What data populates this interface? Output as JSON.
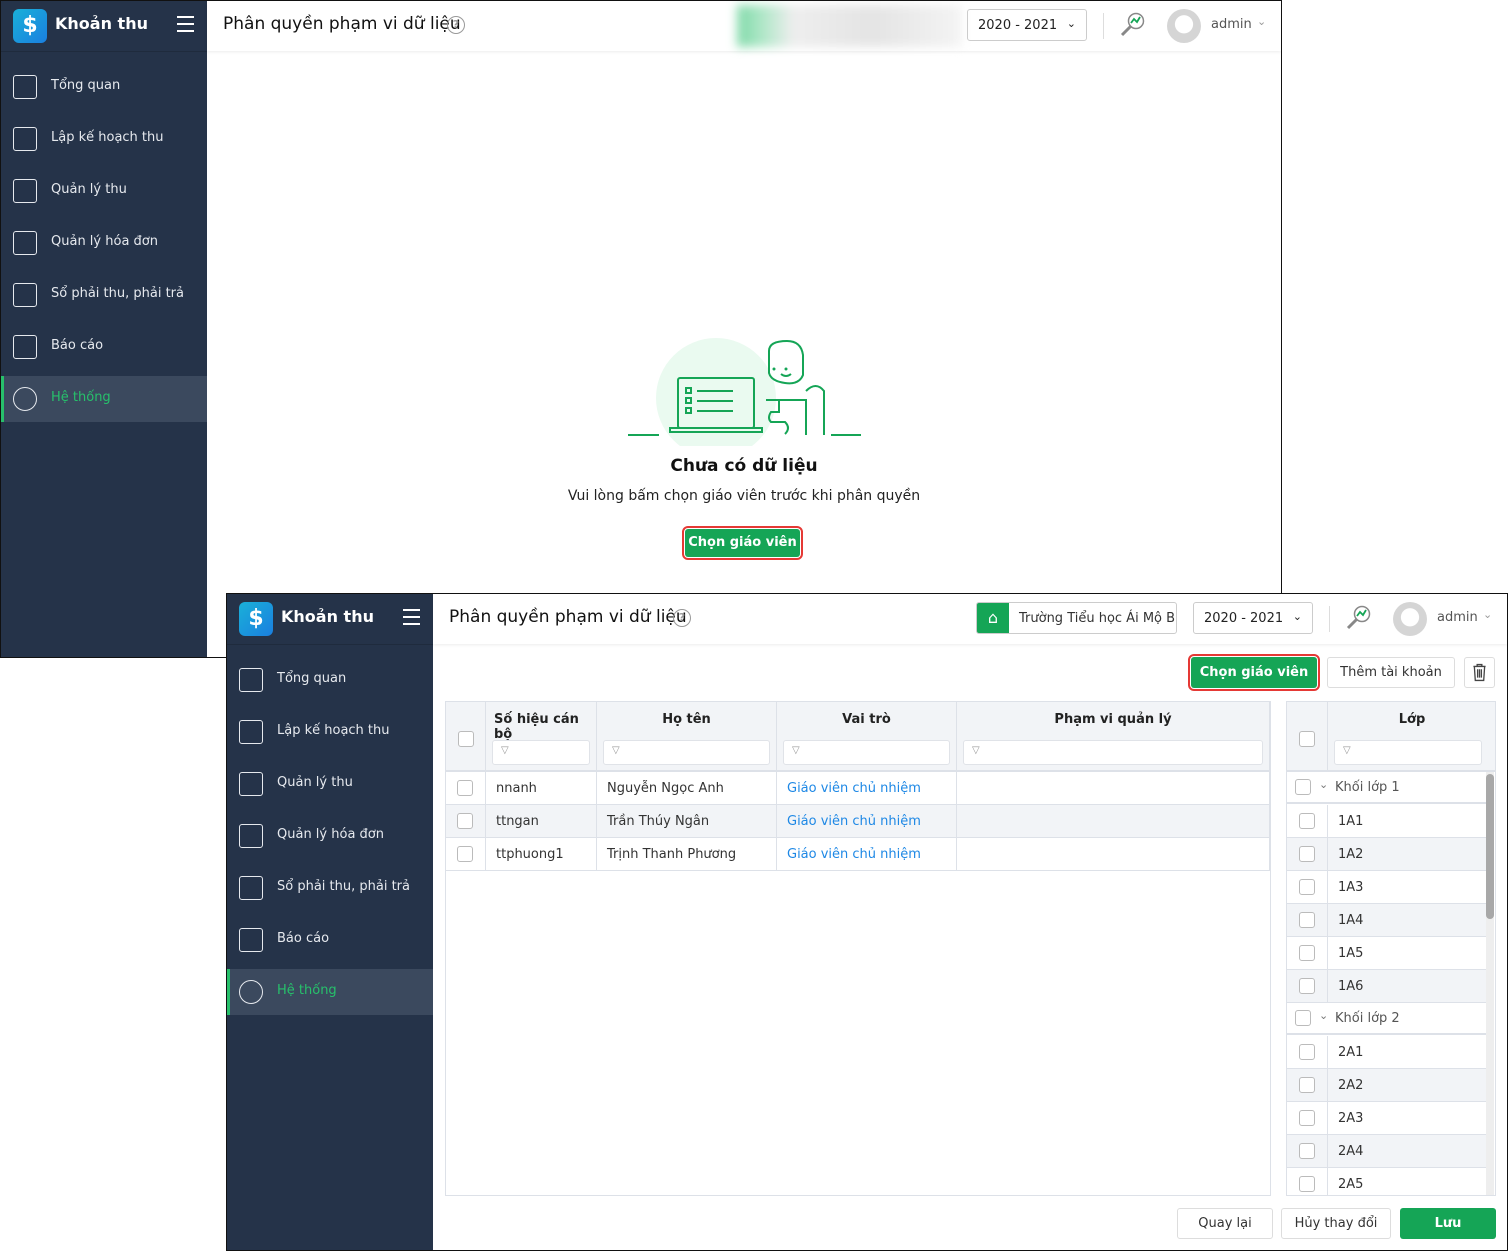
{
  "app": {
    "name": "Khoản thu",
    "logo_glyph": "$"
  },
  "sidebar": {
    "items": [
      {
        "label": "Tổng quan",
        "icon": "bar-chart-icon"
      },
      {
        "label": "Lập kế hoạch thu",
        "icon": "calendar-dollar-icon"
      },
      {
        "label": "Quản lý thu",
        "icon": "hand-coin-icon"
      },
      {
        "label": "Quản lý hóa đơn",
        "icon": "invoice-icon"
      },
      {
        "label": "Sổ phải thu, phải trả",
        "icon": "ledger-book-icon"
      },
      {
        "label": "Báo cáo",
        "icon": "pie-chart-icon"
      },
      {
        "label": "Hệ thống",
        "icon": "gear-icon",
        "active": true
      }
    ]
  },
  "header": {
    "title": "Phân quyền phạm vi dữ liệu",
    "help_glyph": "?",
    "year": "2020 - 2021",
    "user": "admin",
    "school": "Trường Tiểu học Ái Mộ B"
  },
  "empty": {
    "title": "Chưa có dữ liệu",
    "subtitle": "Vui lòng bấm chọn giáo viên trước khi phân quyền",
    "button": "Chọn giáo viên"
  },
  "toolbar": {
    "choose_teacher": "Chọn giáo viên",
    "add_account": "Thêm tài khoản"
  },
  "teachers": {
    "columns": [
      "Số hiệu cán bộ",
      "Họ tên",
      "Vai trò",
      "Phạm vi quản lý"
    ],
    "rows": [
      {
        "code": "nnanh",
        "name": "Nguyễn Ngọc Anh",
        "role": "Giáo viên chủ nhiệm",
        "scope": ""
      },
      {
        "code": "ttngan",
        "name": "Trần Thúy Ngân",
        "role": "Giáo viên chủ nhiệm",
        "scope": ""
      },
      {
        "code": "ttphuong1",
        "name": "Trịnh Thanh Phương",
        "role": "Giáo viên chủ nhiệm",
        "scope": ""
      }
    ]
  },
  "classes": {
    "column": "Lớp",
    "groups": [
      {
        "label": "Khối lớp 1",
        "items": [
          "1A1",
          "1A2",
          "1A3",
          "1A4",
          "1A5",
          "1A6"
        ]
      },
      {
        "label": "Khối lớp 2",
        "items": [
          "2A1",
          "2A2",
          "2A3",
          "2A4",
          "2A5"
        ]
      }
    ]
  },
  "footer": {
    "back": "Quay lại",
    "discard": "Hủy thay đổi",
    "save": "Lưu"
  },
  "colors": {
    "sidebar": "#253349",
    "accent": "#15a556",
    "active_text": "#27c06b",
    "link": "#1e88e5",
    "highlight": "#e53935"
  }
}
